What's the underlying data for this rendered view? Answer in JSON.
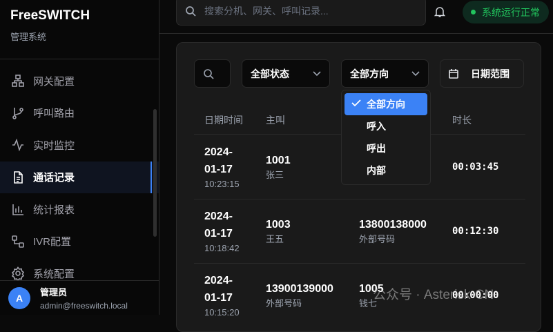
{
  "brand": {
    "title": "FreeSWITCH",
    "subtitle": "管理系统"
  },
  "nav": [
    {
      "label": "网关配置",
      "icon": "network-icon"
    },
    {
      "label": "呼叫路由",
      "icon": "git-branch-icon"
    },
    {
      "label": "实时监控",
      "icon": "activity-icon"
    },
    {
      "label": "通话记录",
      "icon": "file-text-icon",
      "active": true
    },
    {
      "label": "统计报表",
      "icon": "bar-chart-icon"
    },
    {
      "label": "IVR配置",
      "icon": "workflow-icon"
    },
    {
      "label": "系统配置",
      "icon": "gear-icon"
    }
  ],
  "user": {
    "initial": "A",
    "name": "管理员",
    "email": "admin@freeswitch.local"
  },
  "header": {
    "search_placeholder": "搜索分机、网关、呼叫记录...",
    "status": "系统运行正常"
  },
  "filters": {
    "status": "全部状态",
    "direction": "全部方向",
    "date_range": "日期范围"
  },
  "dropdown": {
    "options": [
      "全部方向",
      "呼入",
      "呼出",
      "内部"
    ],
    "selected": "全部方向"
  },
  "table": {
    "headers": [
      "日期时间",
      "主叫",
      "",
      "时长"
    ],
    "rows": [
      {
        "date": "2024-",
        "date2": "01-17",
        "time": "10:23:15",
        "caller": "1001",
        "caller_name": "张三",
        "callee": "",
        "callee_name": "",
        "duration": "00:03:45"
      },
      {
        "date": "2024-",
        "date2": "01-17",
        "time": "10:18:42",
        "caller": "1003",
        "caller_name": "王五",
        "callee": "13800138000",
        "callee_name": "外部号码",
        "duration": "00:12:30"
      },
      {
        "date": "2024-",
        "date2": "01-17",
        "time": "10:15:20",
        "caller": "13900139000",
        "caller_name": "外部号码",
        "callee": "1005",
        "callee_name": "钱七",
        "duration": "00:00:00"
      }
    ]
  },
  "watermark": "公众号 · Asterisk-CN"
}
